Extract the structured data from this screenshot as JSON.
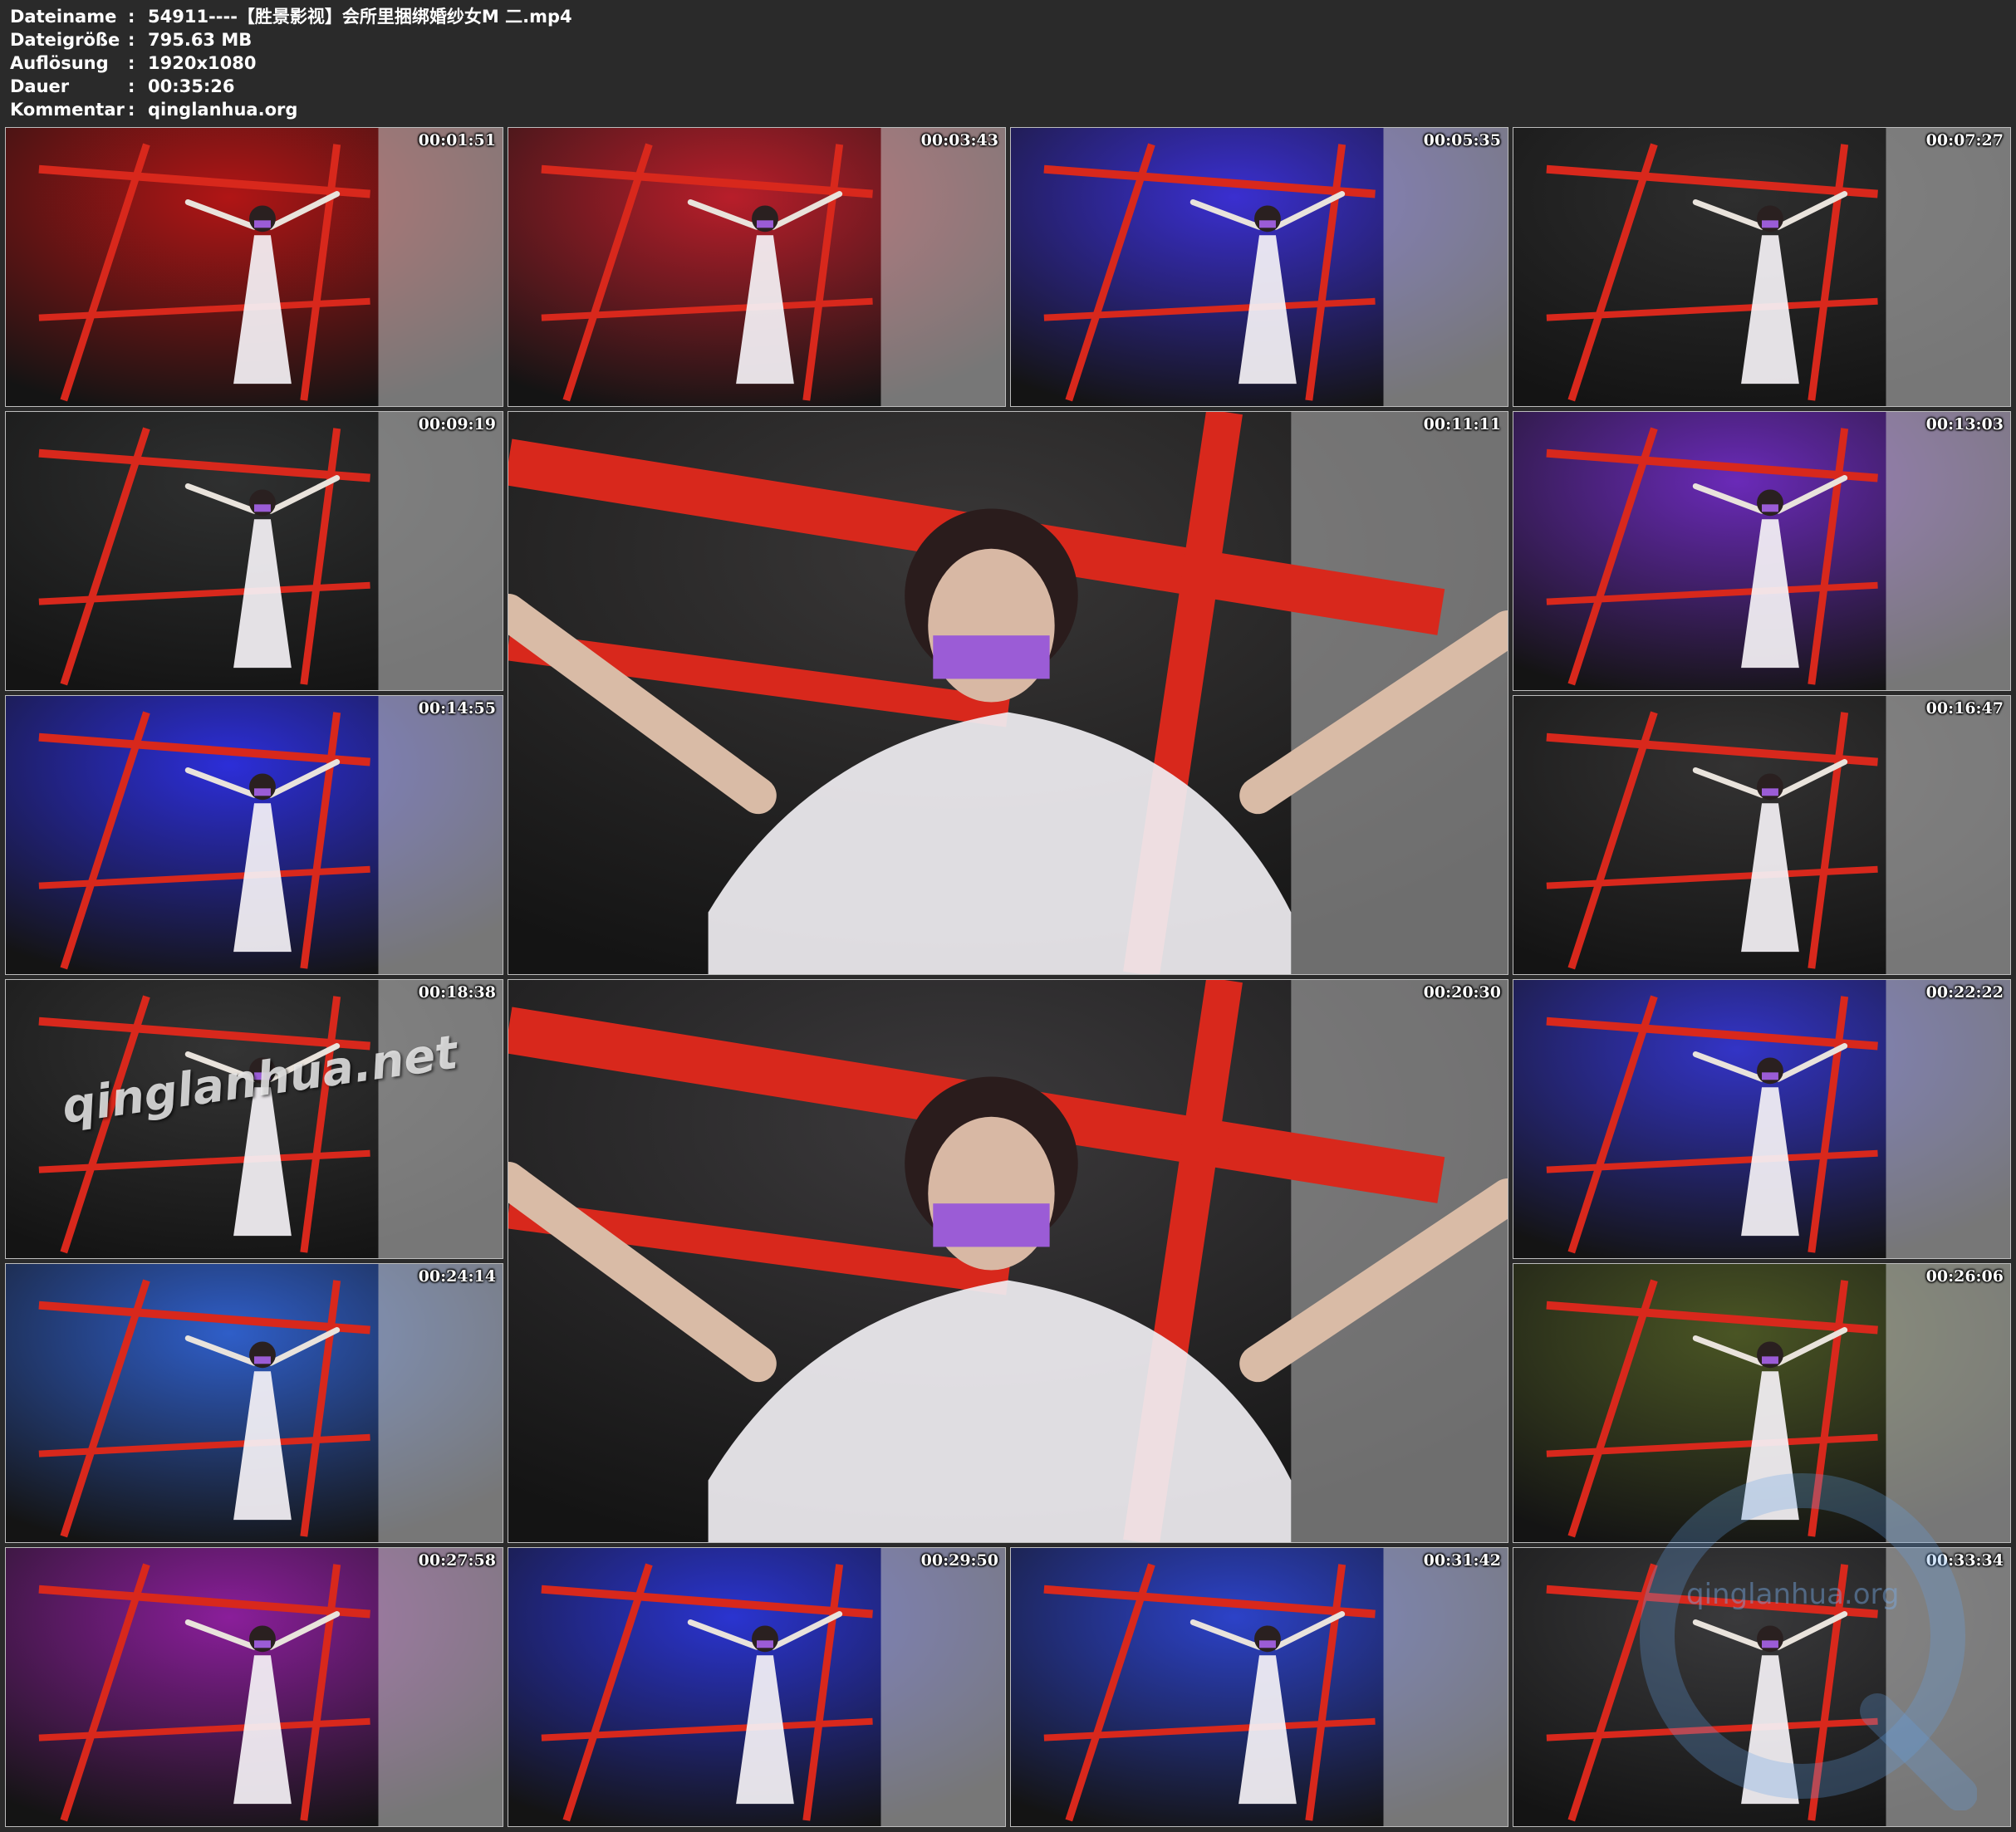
{
  "metadata": [
    {
      "label": "Dateiname",
      "value": "54911----【胜景影视】会所里捆绑婚纱女M 二.mp4"
    },
    {
      "label": "Dateigröße",
      "value": "795.63 MB"
    },
    {
      "label": "Auflösung",
      "value": "1920x1080"
    },
    {
      "label": "Dauer",
      "value": "00:35:26"
    },
    {
      "label": "Kommentar",
      "value": "qinglanhua.org"
    }
  ],
  "separator": ":",
  "thumbnails": [
    {
      "timestamp": "00:01:51",
      "tint": "#b01515"
    },
    {
      "timestamp": "00:03:43",
      "tint": "#b81e2a"
    },
    {
      "timestamp": "00:05:35",
      "tint": "#3a2fd0"
    },
    {
      "timestamp": "00:07:27",
      "tint": "#2e2e2e"
    },
    {
      "timestamp": "00:09:19",
      "tint": "#2f3030"
    },
    {
      "timestamp": "00:11:11",
      "tint": "#3a3838"
    },
    {
      "timestamp": "00:13:03",
      "tint": "#6a2ab8"
    },
    {
      "timestamp": "00:14:55",
      "tint": "#2c2ed8"
    },
    {
      "timestamp": "00:16:47",
      "tint": "#333232"
    },
    {
      "timestamp": "00:18:38",
      "tint": "#343434"
    },
    {
      "timestamp": "00:20:30",
      "tint": "#3c3a3c"
    },
    {
      "timestamp": "00:22:22",
      "tint": "#3334c6"
    },
    {
      "timestamp": "00:24:14",
      "tint": "#2f5ec8"
    },
    {
      "timestamp": "00:26:06",
      "tint": "#4a5524"
    },
    {
      "timestamp": "00:27:58",
      "tint": "#8a1e9a"
    },
    {
      "timestamp": "00:29:50",
      "tint": "#2a34d0"
    },
    {
      "timestamp": "00:31:42",
      "tint": "#2c42c8"
    },
    {
      "timestamp": "00:33:34",
      "tint": "#3a3a3c"
    }
  ],
  "watermarks": {
    "overlay_text": "qinglanhua.net",
    "logo_text": "qinglanhua.org"
  }
}
